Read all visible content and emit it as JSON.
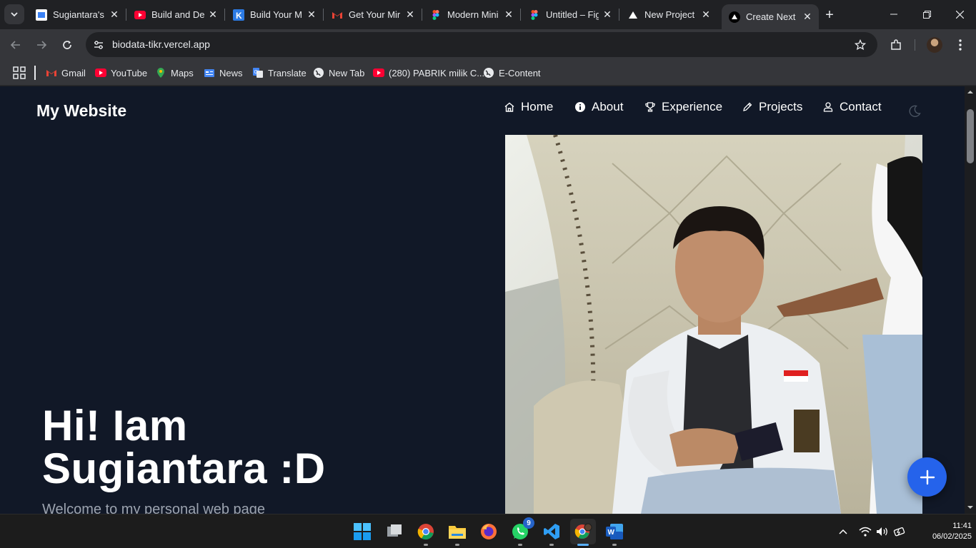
{
  "browser": {
    "tabs": [
      {
        "title": "Sugiantara's",
        "icon": "sugiantara-favicon"
      },
      {
        "title": "Build and De",
        "icon": "youtube-icon"
      },
      {
        "title": "Build Your M",
        "icon": "k-icon"
      },
      {
        "title": "Get Your Mir",
        "icon": "gmail-icon"
      },
      {
        "title": "Modern Mini",
        "icon": "figma-icon"
      },
      {
        "title": "Untitled – Fig",
        "icon": "figma-icon"
      },
      {
        "title": "New Project",
        "icon": "vercel-icon"
      },
      {
        "title": "Create Next",
        "icon": "vercel-icon",
        "active": true
      }
    ],
    "url": "biodata-tikr.vercel.app",
    "bookmarks": [
      {
        "label": "Gmail",
        "icon": "gmail-icon"
      },
      {
        "label": "YouTube",
        "icon": "youtube-icon"
      },
      {
        "label": "Maps",
        "icon": "maps-icon"
      },
      {
        "label": "News",
        "icon": "news-icon"
      },
      {
        "label": "Translate",
        "icon": "translate-icon"
      },
      {
        "label": "New Tab",
        "icon": "globe-icon"
      },
      {
        "label": "(280) PABRIK milik C...",
        "icon": "youtube-icon"
      },
      {
        "label": "E-Content",
        "icon": "globe-icon"
      }
    ]
  },
  "site": {
    "title": "My Website",
    "nav": [
      {
        "label": "Home",
        "icon": "home-icon"
      },
      {
        "label": "About",
        "icon": "info-icon"
      },
      {
        "label": "Experience",
        "icon": "trophy-icon"
      },
      {
        "label": "Projects",
        "icon": "pencil-icon"
      },
      {
        "label": "Contact",
        "icon": "user-icon"
      }
    ],
    "hero": {
      "title_line1": "Hi! Iam",
      "title_line2": "Sugiantara :D",
      "subtitle": "Welcome to my personal web page"
    },
    "accent": "#2563eb",
    "background": "#111827"
  },
  "taskbar": {
    "apps": [
      "windows-start",
      "task-view",
      "chrome",
      "file-explorer",
      "firefox",
      "whatsapp",
      "vscode",
      "chrome-profile",
      "word"
    ],
    "whatsapp_badge": "9",
    "time": "11:41",
    "date": "06/02/2025"
  }
}
